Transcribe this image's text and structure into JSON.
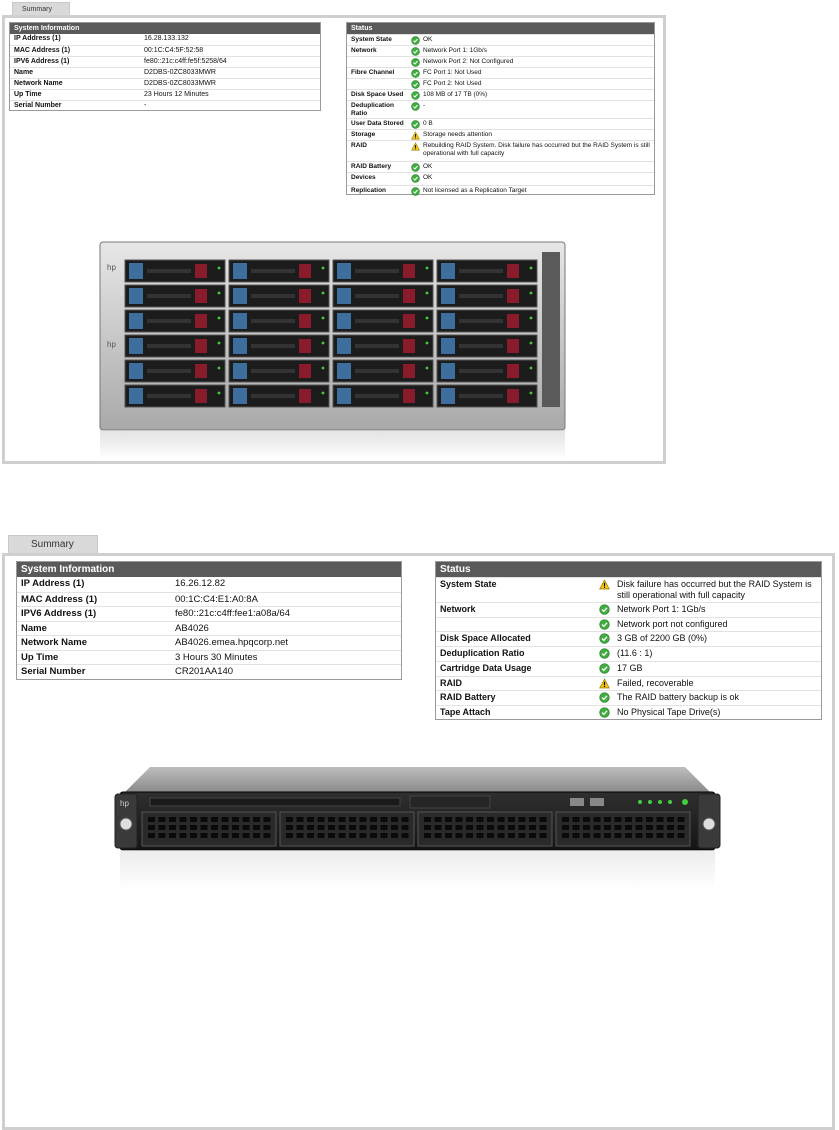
{
  "panel1": {
    "tab_label": "Summary",
    "system_info": {
      "title": "System Information",
      "rows": [
        {
          "label": "IP Address (1)",
          "value": "16.28.133.132"
        },
        {
          "label": "MAC Address (1)",
          "value": "00:1C:C4:5F:52:58"
        },
        {
          "label": "IPV6 Address (1)",
          "value": "fe80::21c:c4ff:fe5f:5258/64"
        },
        {
          "label": "Name",
          "value": "D2DBS-0ZC8033MWR"
        },
        {
          "label": "Network Name",
          "value": "D2DBS-0ZC8033MWR"
        },
        {
          "label": "Up Time",
          "value": "23 Hours 12 Minutes"
        },
        {
          "label": "Serial Number",
          "value": "-"
        }
      ]
    },
    "status": {
      "title": "Status",
      "rows": [
        {
          "label": "System State",
          "icon": "ok",
          "value": "OK"
        },
        {
          "label": "Network",
          "icon": "ok",
          "value": "Network Port 1: 1Gb/s"
        },
        {
          "label": "",
          "icon": "ok",
          "value": "Network Port 2: Not Configured"
        },
        {
          "label": "Fibre Channel",
          "icon": "ok",
          "value": "FC Port 1: Not Used"
        },
        {
          "label": "",
          "icon": "ok",
          "value": "FC Port 2: Not Used"
        },
        {
          "label": "Disk Space Used",
          "icon": "ok",
          "value": "108 MB of 17 TB (0%)"
        },
        {
          "label": "Deduplication Ratio",
          "icon": "ok",
          "value": "-"
        },
        {
          "label": "User Data Stored",
          "icon": "ok",
          "value": "0 B"
        },
        {
          "label": "Storage",
          "icon": "warn",
          "value": "Storage needs attention"
        },
        {
          "label": "RAID",
          "icon": "warn",
          "value": "Rebuilding RAID System. Disk failure has occurred but the RAID System is still operational with full capacity"
        },
        {
          "label": "RAID Battery",
          "icon": "ok",
          "value": "OK"
        },
        {
          "label": "Devices",
          "icon": "ok",
          "value": "OK"
        },
        {
          "label": "Replication",
          "icon": "ok",
          "value": "Not licensed as a Replication Target"
        }
      ]
    }
  },
  "panel2": {
    "tab_label": "Summary",
    "system_info": {
      "title": "System Information",
      "rows": [
        {
          "label": "IP Address (1)",
          "value": "16.26.12.82"
        },
        {
          "label": "MAC Address (1)",
          "value": "00:1C:C4:E1:A0:8A"
        },
        {
          "label": "IPV6 Address (1)",
          "value": "fe80::21c:c4ff:fee1:a08a/64"
        },
        {
          "label": "Name",
          "value": "AB4026"
        },
        {
          "label": "Network Name",
          "value": "AB4026.emea.hpqcorp.net"
        },
        {
          "label": "Up Time",
          "value": "3 Hours 30 Minutes"
        },
        {
          "label": "Serial Number",
          "value": "CR201AA140"
        }
      ]
    },
    "status": {
      "title": "Status",
      "rows": [
        {
          "label": "System State",
          "icon": "warn",
          "value": "Disk failure has occurred but the RAID System is still operational with full capacity"
        },
        {
          "label": "Network",
          "icon": "ok",
          "value": "Network Port 1: 1Gb/s"
        },
        {
          "label": "",
          "icon": "ok",
          "value": "Network port not configured"
        },
        {
          "label": "Disk Space Allocated",
          "icon": "ok",
          "value": "3 GB of 2200 GB (0%)"
        },
        {
          "label": "Deduplication Ratio",
          "icon": "ok",
          "value": "(11.6 : 1)"
        },
        {
          "label": "Cartridge Data Usage",
          "icon": "ok",
          "value": "17 GB"
        },
        {
          "label": "RAID",
          "icon": "warn",
          "value": "Failed, recoverable"
        },
        {
          "label": "RAID Battery",
          "icon": "ok",
          "value": "The RAID battery backup is ok"
        },
        {
          "label": "Tape Attach",
          "icon": "ok",
          "value": "No Physical Tape Drive(s)"
        }
      ]
    }
  },
  "colors": {
    "header_bg": "#5a5a5a",
    "frame_border": "#cfcfcf",
    "ok_green": "#3fae3f",
    "warn_yellow": "#f2c318"
  },
  "icons": {
    "ok": "check-circle-icon",
    "warn": "warning-triangle-icon"
  }
}
